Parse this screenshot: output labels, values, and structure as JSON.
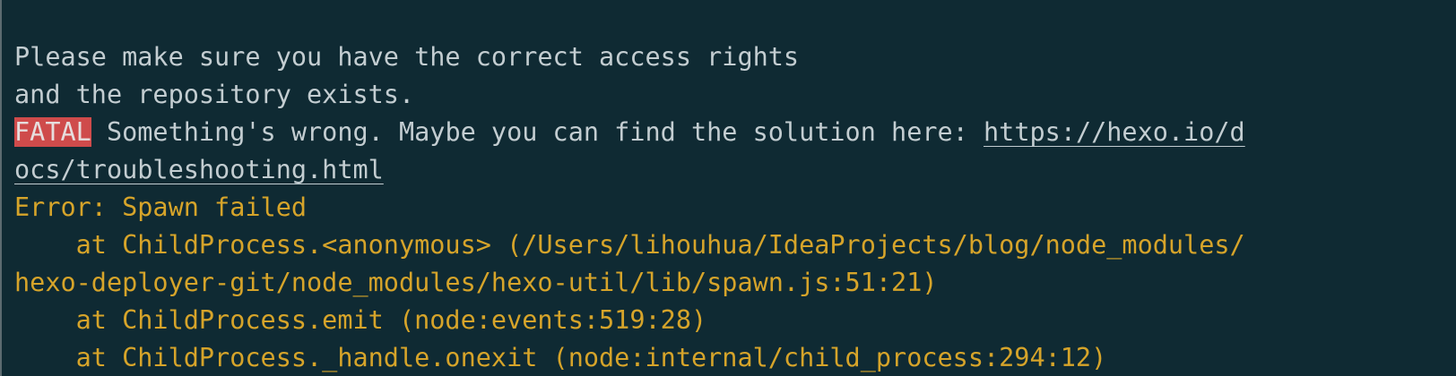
{
  "terminal": {
    "line1": "Please make sure you have the correct access rights",
    "line2": "and the repository exists.",
    "fatal_badge": "FATAL",
    "fatal_message": " Something's wrong. Maybe you can find the solution here: ",
    "link_part1": "https://hexo.io/d",
    "link_part2": "ocs/troubleshooting.html",
    "error_line": "Error: Spawn failed",
    "stack1a": "    at ChildProcess.<anonymous> (/Users/lihouhua/IdeaProjects/blog/node_modules/",
    "stack1b": "hexo-deployer-git/node_modules/hexo-util/lib/spawn.js:51:21)",
    "stack2": "    at ChildProcess.emit (node:events:519:28)",
    "stack3": "    at ChildProcess._handle.onexit (node:internal/child_process:294:12)"
  },
  "colors": {
    "background": "#0f2a33",
    "text": "#c3cdd1",
    "error": "#d6a42a",
    "fatal_badge": "#cf4b4b"
  }
}
